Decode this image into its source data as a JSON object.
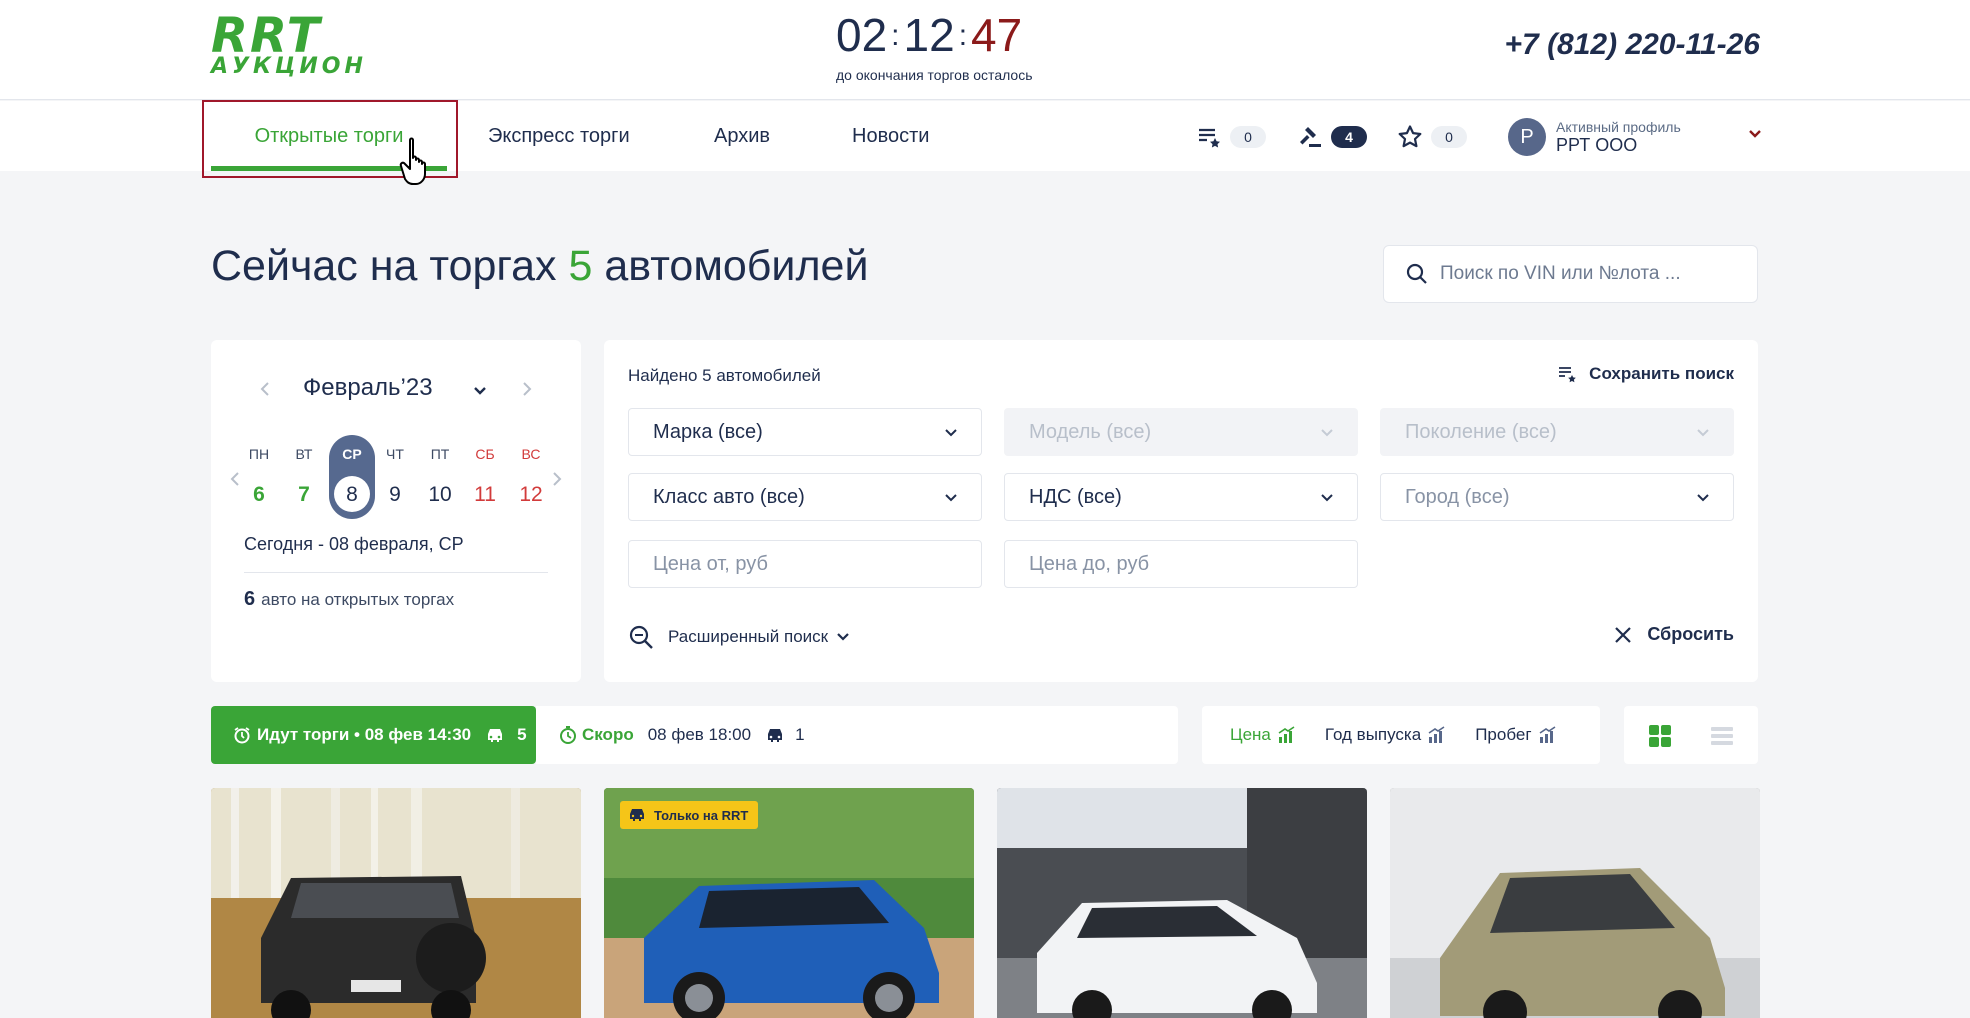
{
  "header": {
    "logo_top": "RRT",
    "logo_bottom": "АУКЦИОН",
    "timer": {
      "hours": "02",
      "minutes": "12",
      "seconds": "47",
      "caption": "до окончания торгов осталось"
    },
    "phone": "+7 (812) 220-11-26"
  },
  "nav": {
    "items": [
      {
        "label": "Открытые торги"
      },
      {
        "label": "Экспресс торги"
      },
      {
        "label": "Архив"
      },
      {
        "label": "Новости"
      }
    ],
    "counters": {
      "list": "0",
      "bids": "4",
      "favorites": "0"
    },
    "profile": {
      "initial": "Р",
      "caption": "Активный профиль",
      "name": "РРТ ООО"
    }
  },
  "main": {
    "title_prefix": "Сейчас на торгах",
    "title_count": "5",
    "title_suffix": "автомобилей",
    "search_placeholder": "Поиск по VIN или №лота ..."
  },
  "calendar": {
    "month": "Февраль’23",
    "days": [
      {
        "name": "ПН",
        "date": "6"
      },
      {
        "name": "ВТ",
        "date": "7"
      },
      {
        "name": "СР",
        "date": "8"
      },
      {
        "name": "ЧТ",
        "date": "9"
      },
      {
        "name": "ПТ",
        "date": "10"
      },
      {
        "name": "СБ",
        "date": "11"
      },
      {
        "name": "ВС",
        "date": "12"
      }
    ],
    "today": "Сегодня - 08 февраля, СР",
    "count": "6",
    "count_label": "авто на открытых торгах"
  },
  "filters": {
    "found": "Найдено 5 автомобилей",
    "save_search": "Сохранить поиск",
    "brand": "Марка (все)",
    "model": "Модель (все)",
    "generation": "Поколение (все)",
    "class": "Класс авто (все)",
    "vat": "НДС (все)",
    "city": "Город (все)",
    "price_from": "Цена от, руб",
    "price_to": "Цена до, руб",
    "advanced": "Расширенный поиск",
    "reset": "Сбросить"
  },
  "status": {
    "live": "Идут торги • 08 фев 14:30",
    "live_count": "5",
    "soon_label": "Скоро",
    "soon_date": "08 фев 18:00",
    "soon_count": "1"
  },
  "sort": {
    "price": "Цена",
    "year": "Год выпуска",
    "mileage": "Пробег"
  },
  "cards": {
    "badge": "Только на RRT"
  },
  "colors": {
    "accent_green": "#3aa537",
    "navy": "#1f2d4d",
    "weekend_red": "#d23b3b",
    "timer_seconds": "#8b1a1a",
    "badge_yellow": "#f5c518"
  }
}
